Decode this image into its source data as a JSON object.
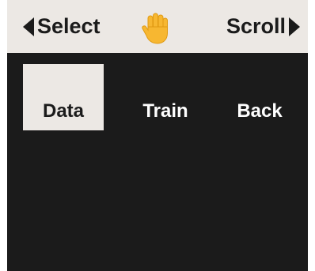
{
  "topbar": {
    "left_label": "Select",
    "right_label": "Scroll",
    "left_arrow_icon": "triangle-left-icon",
    "right_arrow_icon": "triangle-right-icon",
    "center_icon": "raised-hand-icon"
  },
  "menu": {
    "items": [
      {
        "label": "Data",
        "selected": true
      },
      {
        "label": "Train",
        "selected": false
      },
      {
        "label": "Back",
        "selected": false
      }
    ]
  },
  "colors": {
    "screen_background": "#1b1b1b",
    "bar_background": "#ece8e4",
    "selected_background": "#ece8e4",
    "text_light": "#ffffff",
    "text_dark": "#1b1b1b",
    "hand": "#f7b731"
  }
}
